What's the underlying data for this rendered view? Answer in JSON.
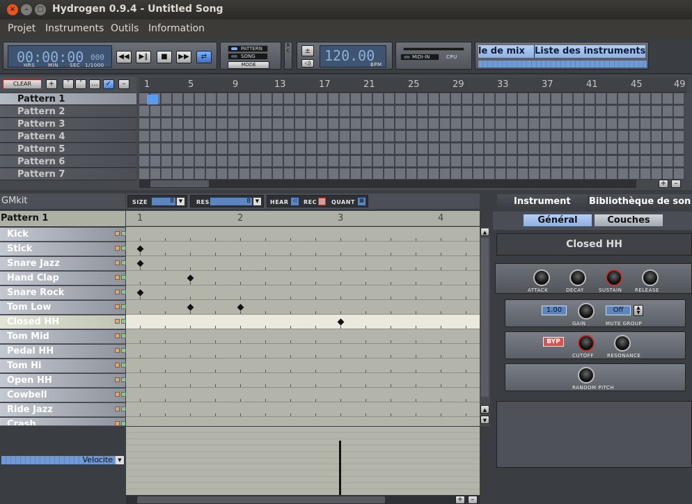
{
  "window": {
    "title": "Hydrogen 0.9.4 - Untitled Song"
  },
  "menu": [
    "Projet",
    "Instruments",
    "Outils",
    "Information"
  ],
  "transport": {
    "time": "00:00:00",
    "ms": "000",
    "units": [
      "HRS",
      "MIN",
      "SEC",
      "1/1000"
    ],
    "bpm": "120.00",
    "bpm_label": "BPM",
    "mode_pattern": "PATTERN",
    "mode_song": "SONG",
    "mode_button": "MODE",
    "midi_in": "MIDI-IN",
    "cpu": "CPU",
    "bc": "B C",
    "mixer_text": "le de mix",
    "instlist_text": "Liste des instruments"
  },
  "song": {
    "clear": "CLEAR",
    "patterns": [
      "Pattern 1",
      "Pattern 2",
      "Pattern 3",
      "Pattern 4",
      "Pattern 5",
      "Pattern 6",
      "Pattern 7"
    ],
    "ruler": [
      "1",
      "5",
      "9",
      "13",
      "17",
      "21",
      "25",
      "29",
      "33",
      "37",
      "41",
      "45",
      "49"
    ],
    "active_cell": {
      "pattern": 0,
      "bar": 1
    }
  },
  "pattern_editor": {
    "kit": "GMkit",
    "pattern": "Pattern 1",
    "size_label": "SIZE",
    "size": "8",
    "res_label": "RES.",
    "res": "8",
    "hear": "HEAR",
    "rec": "REC",
    "quant": "QUANT",
    "ruler": [
      "1",
      "2",
      "3",
      "4"
    ],
    "velocity": "Velocite",
    "instruments": [
      "Kick",
      "Stick",
      "Snare Jazz",
      "Hand Clap",
      "Snare Rock",
      "Tom Low",
      "Closed HH",
      "Tom Mid",
      "Pedal HH",
      "Tom Hi",
      "Open HH",
      "Cowbell",
      "Ride Jazz",
      "Crash"
    ],
    "selected_instrument": 6,
    "notes": [
      {
        "row": 1,
        "tick": 0
      },
      {
        "row": 2,
        "tick": 0
      },
      {
        "row": 3,
        "tick": 2
      },
      {
        "row": 4,
        "tick": 0
      },
      {
        "row": 5,
        "tick": 2
      },
      {
        "row": 5,
        "tick": 4
      },
      {
        "row": 6,
        "tick": 8
      }
    ]
  },
  "instrument_panel": {
    "tab_instrument": "Instrument",
    "tab_library": "Bibliothèque de son",
    "tab_general": "Général",
    "tab_layers": "Couches",
    "name": "Closed HH",
    "adsr": [
      "ATTACK",
      "DECAY",
      "SUSTAIN",
      "RELEASE"
    ],
    "gain_value": "1.00",
    "gain": "GAIN",
    "mute_value": "Off",
    "mute": "MUTE GROUP",
    "filter": "BYP",
    "cutoff": "CUTOFF",
    "resonance": "RESONANCE",
    "random_pitch": "RANDOM PITCH"
  }
}
